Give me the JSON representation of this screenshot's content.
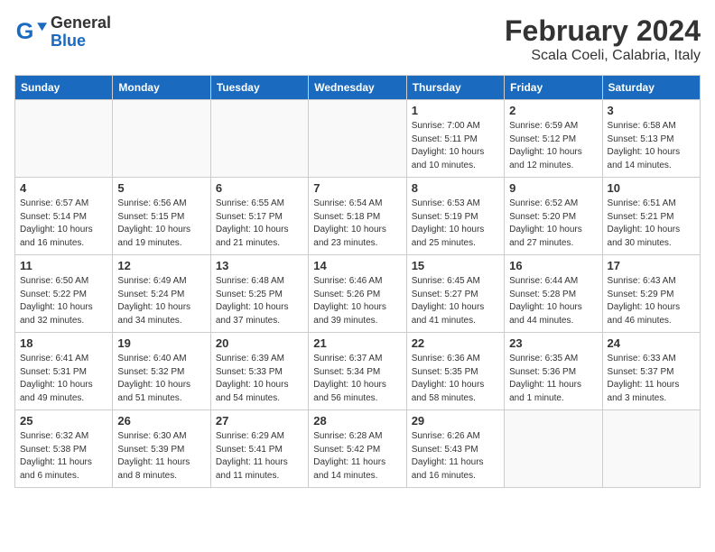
{
  "header": {
    "logo_general": "General",
    "logo_blue": "Blue",
    "month_title": "February 2024",
    "location": "Scala Coeli, Calabria, Italy"
  },
  "weekdays": [
    "Sunday",
    "Monday",
    "Tuesday",
    "Wednesday",
    "Thursday",
    "Friday",
    "Saturday"
  ],
  "weeks": [
    [
      {
        "day": "",
        "info": ""
      },
      {
        "day": "",
        "info": ""
      },
      {
        "day": "",
        "info": ""
      },
      {
        "day": "",
        "info": ""
      },
      {
        "day": "1",
        "info": "Sunrise: 7:00 AM\nSunset: 5:11 PM\nDaylight: 10 hours\nand 10 minutes."
      },
      {
        "day": "2",
        "info": "Sunrise: 6:59 AM\nSunset: 5:12 PM\nDaylight: 10 hours\nand 12 minutes."
      },
      {
        "day": "3",
        "info": "Sunrise: 6:58 AM\nSunset: 5:13 PM\nDaylight: 10 hours\nand 14 minutes."
      }
    ],
    [
      {
        "day": "4",
        "info": "Sunrise: 6:57 AM\nSunset: 5:14 PM\nDaylight: 10 hours\nand 16 minutes."
      },
      {
        "day": "5",
        "info": "Sunrise: 6:56 AM\nSunset: 5:15 PM\nDaylight: 10 hours\nand 19 minutes."
      },
      {
        "day": "6",
        "info": "Sunrise: 6:55 AM\nSunset: 5:17 PM\nDaylight: 10 hours\nand 21 minutes."
      },
      {
        "day": "7",
        "info": "Sunrise: 6:54 AM\nSunset: 5:18 PM\nDaylight: 10 hours\nand 23 minutes."
      },
      {
        "day": "8",
        "info": "Sunrise: 6:53 AM\nSunset: 5:19 PM\nDaylight: 10 hours\nand 25 minutes."
      },
      {
        "day": "9",
        "info": "Sunrise: 6:52 AM\nSunset: 5:20 PM\nDaylight: 10 hours\nand 27 minutes."
      },
      {
        "day": "10",
        "info": "Sunrise: 6:51 AM\nSunset: 5:21 PM\nDaylight: 10 hours\nand 30 minutes."
      }
    ],
    [
      {
        "day": "11",
        "info": "Sunrise: 6:50 AM\nSunset: 5:22 PM\nDaylight: 10 hours\nand 32 minutes."
      },
      {
        "day": "12",
        "info": "Sunrise: 6:49 AM\nSunset: 5:24 PM\nDaylight: 10 hours\nand 34 minutes."
      },
      {
        "day": "13",
        "info": "Sunrise: 6:48 AM\nSunset: 5:25 PM\nDaylight: 10 hours\nand 37 minutes."
      },
      {
        "day": "14",
        "info": "Sunrise: 6:46 AM\nSunset: 5:26 PM\nDaylight: 10 hours\nand 39 minutes."
      },
      {
        "day": "15",
        "info": "Sunrise: 6:45 AM\nSunset: 5:27 PM\nDaylight: 10 hours\nand 41 minutes."
      },
      {
        "day": "16",
        "info": "Sunrise: 6:44 AM\nSunset: 5:28 PM\nDaylight: 10 hours\nand 44 minutes."
      },
      {
        "day": "17",
        "info": "Sunrise: 6:43 AM\nSunset: 5:29 PM\nDaylight: 10 hours\nand 46 minutes."
      }
    ],
    [
      {
        "day": "18",
        "info": "Sunrise: 6:41 AM\nSunset: 5:31 PM\nDaylight: 10 hours\nand 49 minutes."
      },
      {
        "day": "19",
        "info": "Sunrise: 6:40 AM\nSunset: 5:32 PM\nDaylight: 10 hours\nand 51 minutes."
      },
      {
        "day": "20",
        "info": "Sunrise: 6:39 AM\nSunset: 5:33 PM\nDaylight: 10 hours\nand 54 minutes."
      },
      {
        "day": "21",
        "info": "Sunrise: 6:37 AM\nSunset: 5:34 PM\nDaylight: 10 hours\nand 56 minutes."
      },
      {
        "day": "22",
        "info": "Sunrise: 6:36 AM\nSunset: 5:35 PM\nDaylight: 10 hours\nand 58 minutes."
      },
      {
        "day": "23",
        "info": "Sunrise: 6:35 AM\nSunset: 5:36 PM\nDaylight: 11 hours\nand 1 minute."
      },
      {
        "day": "24",
        "info": "Sunrise: 6:33 AM\nSunset: 5:37 PM\nDaylight: 11 hours\nand 3 minutes."
      }
    ],
    [
      {
        "day": "25",
        "info": "Sunrise: 6:32 AM\nSunset: 5:38 PM\nDaylight: 11 hours\nand 6 minutes."
      },
      {
        "day": "26",
        "info": "Sunrise: 6:30 AM\nSunset: 5:39 PM\nDaylight: 11 hours\nand 8 minutes."
      },
      {
        "day": "27",
        "info": "Sunrise: 6:29 AM\nSunset: 5:41 PM\nDaylight: 11 hours\nand 11 minutes."
      },
      {
        "day": "28",
        "info": "Sunrise: 6:28 AM\nSunset: 5:42 PM\nDaylight: 11 hours\nand 14 minutes."
      },
      {
        "day": "29",
        "info": "Sunrise: 6:26 AM\nSunset: 5:43 PM\nDaylight: 11 hours\nand 16 minutes."
      },
      {
        "day": "",
        "info": ""
      },
      {
        "day": "",
        "info": ""
      }
    ]
  ]
}
